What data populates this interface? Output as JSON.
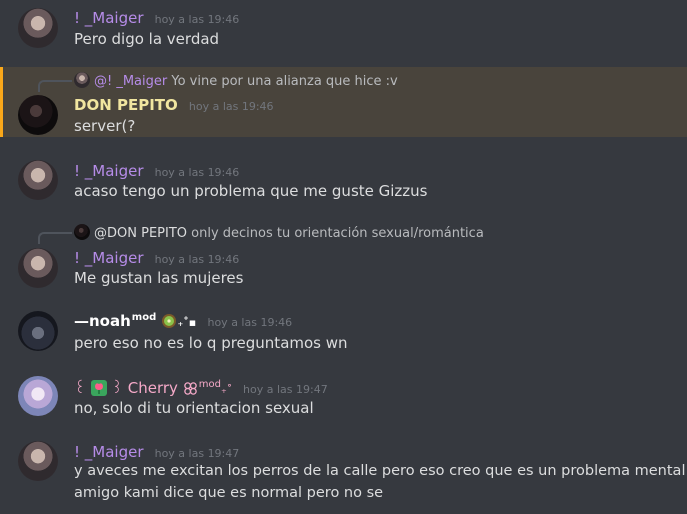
{
  "messages": [
    {
      "author": "! _Maiger",
      "author_color": "#b68ce8",
      "time": "hoy a las 19:46",
      "text": "Pero digo la verdad"
    },
    {
      "reply_author": "@! _Maiger",
      "reply_text": "Yo vine por una alianza que hice :v",
      "author": "DON PEPITO",
      "author_color": "#f1e6a0",
      "time": "hoy a las 19:46",
      "text": "server(?"
    },
    {
      "author": "! _Maiger",
      "author_color": "#b68ce8",
      "time": "hoy a las 19:46",
      "text": "acaso tengo un problema que me guste Gizzus"
    },
    {
      "reply_author": "@DON PEPITO",
      "reply_text": "only decinos tu orientación sexual/romántica",
      "author": "! _Maiger",
      "author_color": "#b68ce8",
      "time": "hoy a las 19:46",
      "text": "Me gustan las mujeres"
    },
    {
      "author": "—noah",
      "author_badge": "mod",
      "author_suffix": "₊˚▪",
      "author_color": "#ffffff",
      "time": "hoy a las 19:46",
      "text": "pero eso no es lo q preguntamos wn"
    },
    {
      "author_prefix": "꒰",
      "author_mid": "꒱",
      "author": "Cherry",
      "author_badge": "mod",
      "author_suffix": "₊˚",
      "author_color": "#f5a9c8",
      "time": "hoy a las 19:47",
      "text": "no, solo di tu orientacion sexual"
    },
    {
      "author": "! _Maiger",
      "author_color": "#b68ce8",
      "time": "hoy a las 19:47",
      "text": "y aveces me excitan los perros de la calle pero eso creo que es un problema mental mi",
      "text2": "amigo kami dice que es normal pero no se"
    }
  ]
}
